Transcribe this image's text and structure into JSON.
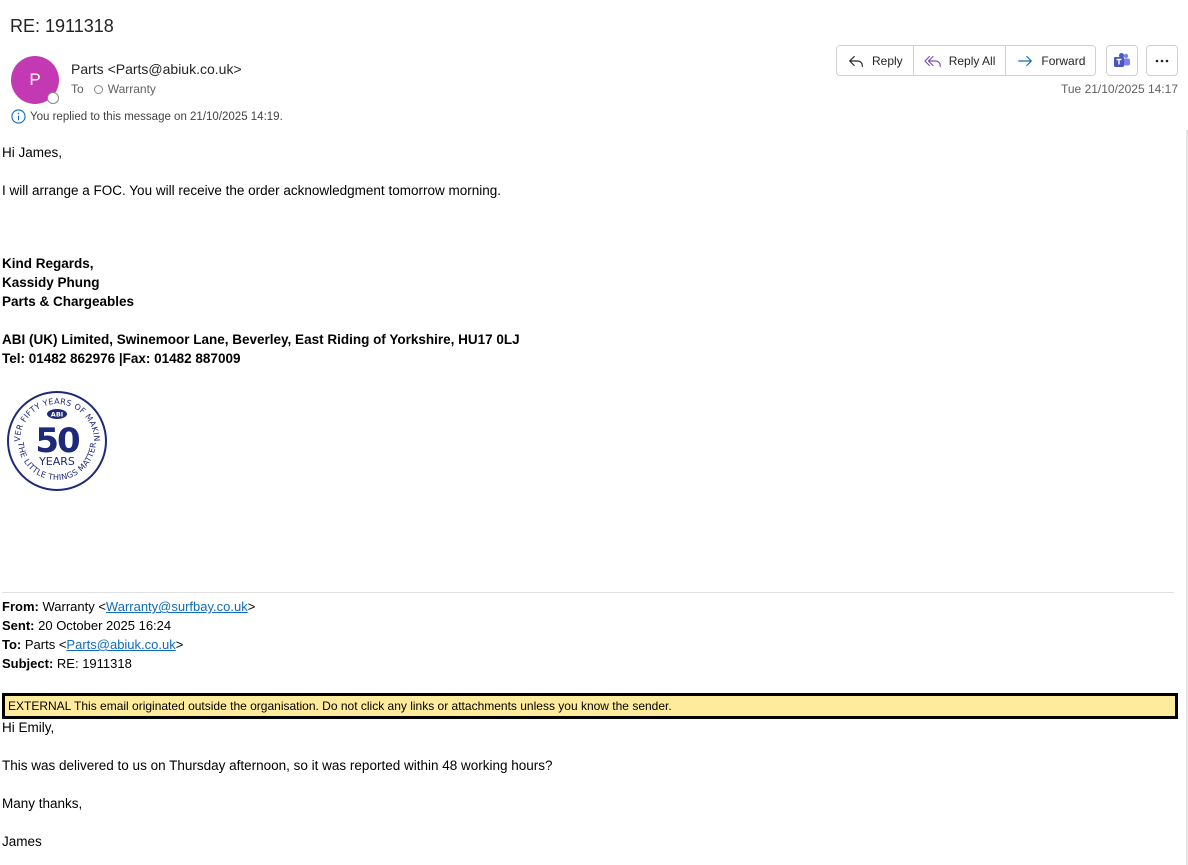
{
  "subject": "RE: 1911318",
  "sender": {
    "avatar_letter": "P",
    "display": "Parts <Parts@abiuk.co.uk>",
    "to_label": "To",
    "recipient": "Warranty"
  },
  "replied_note": "You replied to this message on 21/10/2025 14:19.",
  "actions": {
    "reply": "Reply",
    "reply_all": "Reply All",
    "forward": "Forward"
  },
  "date": "Tue 21/10/2025 14:17",
  "body": {
    "greeting": "Hi James,",
    "line1": "I will arrange a FOC. You will receive the order acknowledgment tomorrow morning.",
    "sig1": "Kind Regards,",
    "sig2": "Kassidy Phung",
    "sig3": "Parts & Chargeables",
    "address": "ABI (UK) Limited, Swinemoor Lane, Beverley, East Riding of Yorkshire, HU17 0LJ",
    "phone": "Tel: 01482 862976 |Fax: 01482 887009",
    "logo_text": "OVER FIFTY YEARS OF MAKING THE LITTLE THINGS MATTER ABI 50 YEARS"
  },
  "quoted": {
    "from_label": "From:",
    "from_name": "Warranty <",
    "from_email": "Warranty@surfbay.co.uk",
    "from_end": ">",
    "sent_label": "Sent:",
    "sent_value": "20 October 2025 16:24",
    "to_label": "To:",
    "to_name": "Parts <",
    "to_email": "Parts@abiuk.co.uk",
    "to_end": ">",
    "subject_label": "Subject:",
    "subject_value": "RE: 1911318"
  },
  "external_banner": "EXTERNAL This email originated outside the organisation. Do not click any links or attachments unless you know the sender.",
  "quoted_body": {
    "greeting": "Hi Emily,",
    "line1": "This was delivered to us on Thursday afternoon, so it was reported within 48 working hours?",
    "line2": "Many thanks,",
    "sign": "James"
  },
  "colors": {
    "avatar": "#c239b3",
    "link": "#0f6cbd",
    "banner": "#ffeb9c",
    "logo": "#1e2a78"
  }
}
